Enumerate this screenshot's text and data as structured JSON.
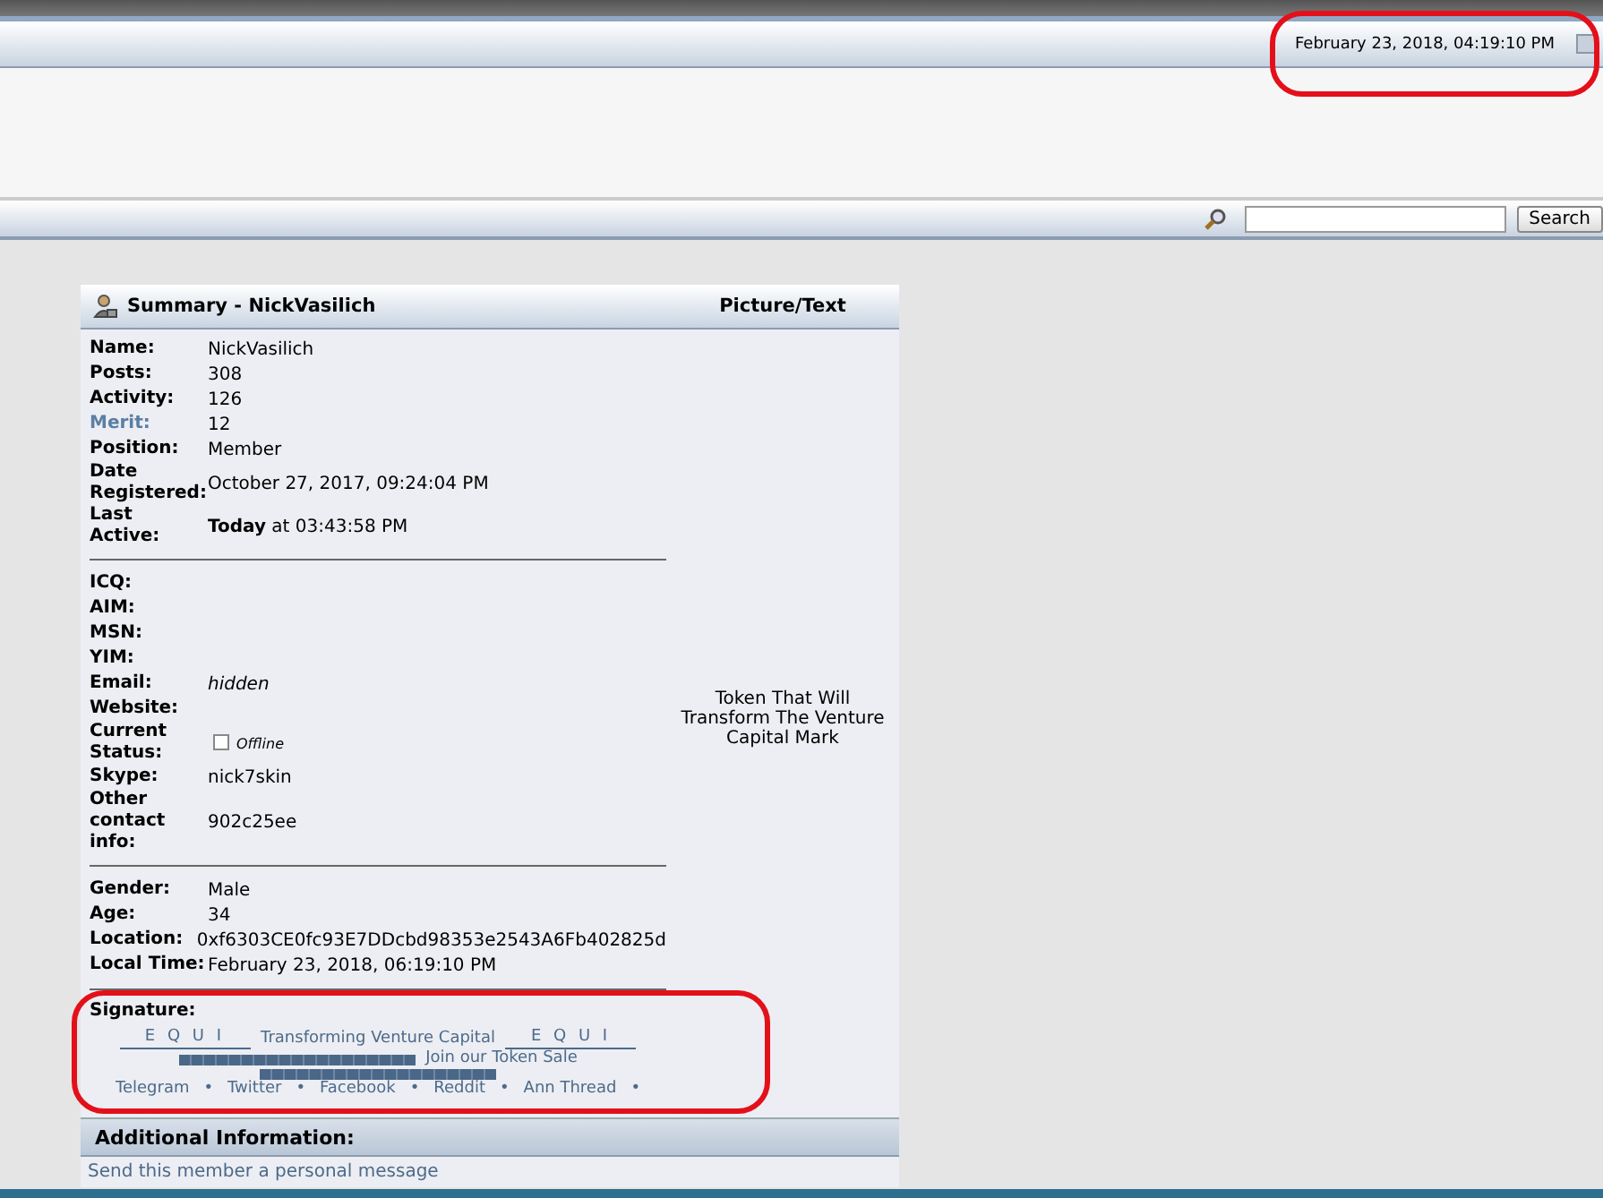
{
  "header": {
    "clock": "February 23, 2018, 04:19:10 PM",
    "clock_highlighted": true
  },
  "search": {
    "button": "Search"
  },
  "profile": {
    "title": "Summary - NickVasilich",
    "side_title": "Picture/Text",
    "side_text": "Token That Will Transform The Venture Capital Mark",
    "groups": [
      [
        {
          "label": "Name:",
          "value": "NickVasilich",
          "kind": "text"
        },
        {
          "label": "Posts:",
          "value": "308",
          "kind": "text"
        },
        {
          "label": "Activity:",
          "value": "126",
          "kind": "text"
        },
        {
          "label": "Merit:",
          "value": "12",
          "kind": "link"
        },
        {
          "label": "Position:",
          "value": "Member",
          "kind": "text"
        },
        {
          "label": "Date Registered:",
          "value": "October 27, 2017, 09:24:04 PM",
          "kind": "text"
        },
        {
          "label": "Last Active:",
          "value": "**Today** at 03:43:58 PM",
          "kind": "text"
        }
      ],
      [
        {
          "label": "ICQ:",
          "kind": "text"
        },
        {
          "label": "AIM:",
          "kind": "text"
        },
        {
          "label": "MSN:",
          "kind": "text"
        },
        {
          "label": "YIM:",
          "kind": "text"
        },
        {
          "label": "Email:",
          "value": "hidden",
          "kind": "italic"
        },
        {
          "label": "Website:",
          "kind": "text"
        },
        {
          "label": "Current Status:",
          "value": "Offline",
          "kind": "status",
          "online": false
        },
        {
          "label": "Skype:",
          "value": "nick7skin",
          "kind": "text"
        },
        {
          "label": "Other contact info:",
          "value": "902c25ee",
          "kind": "text"
        }
      ],
      [
        {
          "label": "Gender:",
          "value": "Male",
          "kind": "text"
        },
        {
          "label": "Age:",
          "value": "34",
          "kind": "text"
        },
        {
          "label": "Location:",
          "value": "0xf6303CE0fc93E7DDcbd98353e2543A6Fb402825d",
          "kind": "text"
        },
        {
          "label": "Local Time:",
          "value": "February 23, 2018, 06:19:10 PM",
          "kind": "text"
        }
      ]
    ],
    "signature": {
      "label": "Signature:",
      "highlighted": true,
      "line1": [
        "E Q U I",
        "Transforming Venture Capital",
        "E Q U I"
      ],
      "join": "Join our Token Sale",
      "links": [
        "Telegram",
        "Twitter",
        "Facebook",
        "Reddit",
        "Ann Thread"
      ],
      "separator": "•"
    },
    "additional": {
      "title": "Additional Information:",
      "link": "Send this member a personal message"
    }
  }
}
